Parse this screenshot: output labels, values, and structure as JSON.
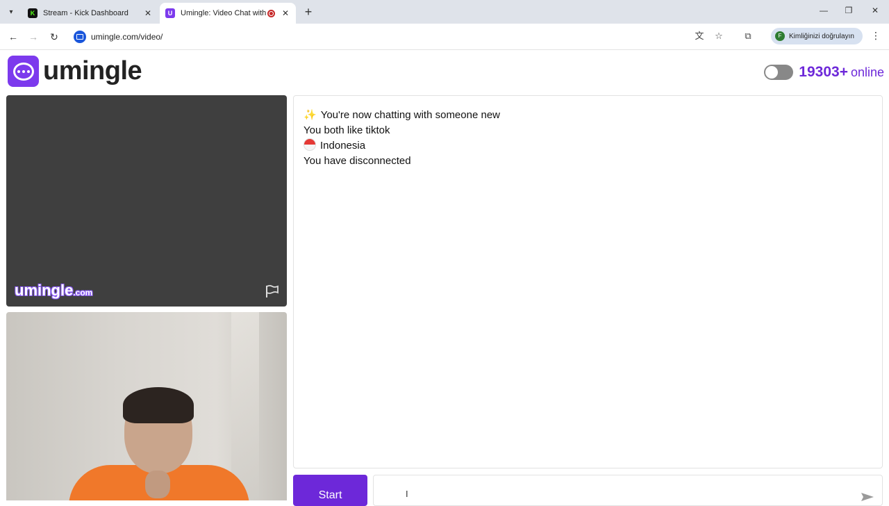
{
  "browser": {
    "tabs": [
      {
        "title": "Stream - Kick Dashboard",
        "favicon": "K"
      },
      {
        "title": "Umingle: Video Chat with S",
        "favicon": "U"
      }
    ],
    "url": "umingle.com/video/",
    "profile_label": "Kimliğinizi doğrulayın",
    "profile_initial": "F"
  },
  "header": {
    "logo_text": "umingle",
    "online_count": "19303",
    "online_plus": "+",
    "online_label": "online"
  },
  "video": {
    "watermark_main": "umingle",
    "watermark_suffix": ".com"
  },
  "chat": {
    "messages": {
      "new_chat": "You're now chatting with someone new",
      "interests": "You both like tiktok",
      "country": "Indonesia",
      "status": "You have disconnected"
    },
    "start_label": "Start",
    "input_placeholder": ""
  },
  "colors": {
    "accent": "#6d28d9",
    "brand": "#7c3aed"
  }
}
